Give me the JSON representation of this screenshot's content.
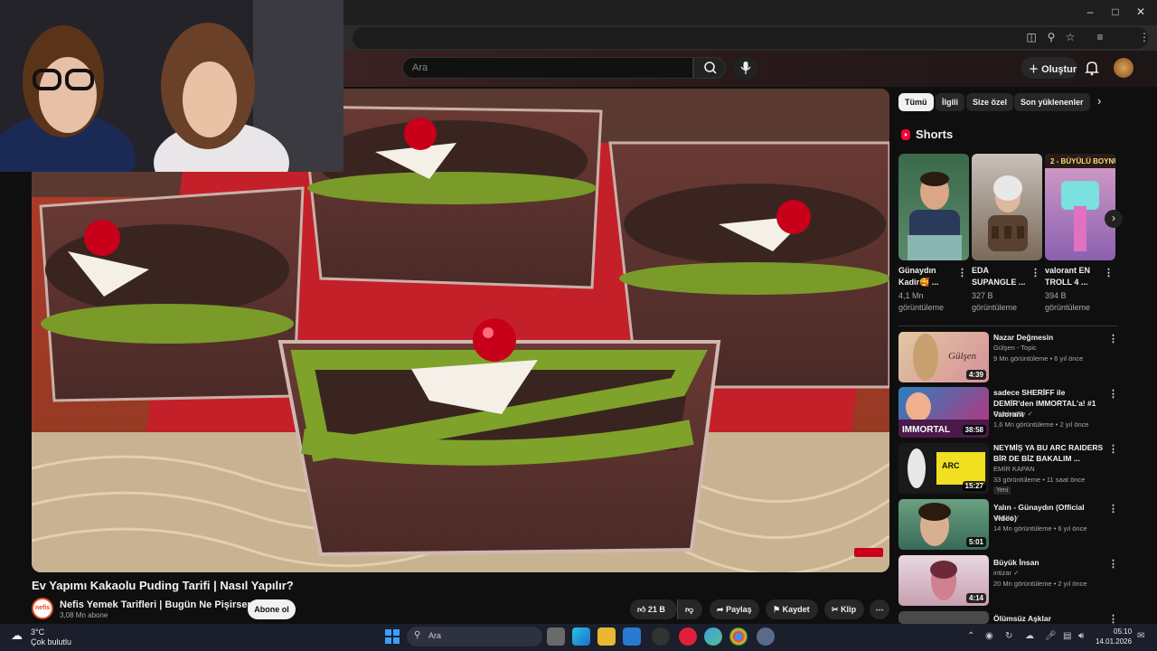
{
  "search": {
    "placeholder": "Ara"
  },
  "header": {
    "create_label": "Oluştur"
  },
  "video": {
    "title": "Ev Yapımı Kakaolu Puding Tarifi | Nasıl Yapılır?",
    "channel": "Nefis Yemek Tarifleri | Bugün Ne Pişirsem?",
    "subscribers": "3,08 Mn abone",
    "subscribe_label": "Abone ol",
    "channel_logo_text": "nefis",
    "likes": "21 B",
    "share_label": "Paylaş",
    "save_label": "Kaydet",
    "clip_label": "Klip"
  },
  "chips": [
    "Tümü",
    "İlgili",
    "Size özel",
    "Son yüklenenler"
  ],
  "shorts_title": "Shorts",
  "shorts": [
    {
      "title": "Günaydın Kadir🥰 ...",
      "views": "4,1 Mn görüntüleme"
    },
    {
      "title": "EDA SUPANGLE ...",
      "views": "327 B görüntüleme"
    },
    {
      "title": "valorant EN TROLL 4 ...",
      "views": "394 B görüntüleme",
      "overlay": "2 - BÜYÜLÜ BOYNUZ"
    }
  ],
  "recommendations": [
    {
      "title": "Nazar Değmesin",
      "channel": "Gülşen - Topic",
      "meta": "9 Mn görüntüleme • 6 yıl önce",
      "duration": "4:39"
    },
    {
      "title": "sadece SHERİFF ile DEMİR'den IMMORTAL'a! #1 Valorant",
      "channel": "CombatRy ✓",
      "meta": "1,6 Mn görüntüleme • 2 yıl önce",
      "duration": "38:58"
    },
    {
      "title": "NEYMİŞ YA BU ARC RAIDERS BİR DE BİZ BAKALIM ...",
      "channel": "EMİR KAPAN",
      "meta": "33 görüntüleme • 11 saat önce",
      "duration": "15:27",
      "badge": "Yeni"
    },
    {
      "title": "Yalın - Günaydın (Official Video)",
      "channel": "YALIN ✓",
      "meta": "14 Mn görüntüleme • 6 yıl önce",
      "duration": "5:01"
    },
    {
      "title": "Büyük İnsan",
      "channel": "intizar ✓",
      "meta": "20 Mn görüntüleme • 2 yıl önce",
      "duration": "4:14"
    },
    {
      "title": "Ölümsüz Aşklar"
    }
  ],
  "taskbar": {
    "weather_temp": "3°C",
    "weather_desc": "Çok bulutlu",
    "search_label": "Ara",
    "time": "05:10",
    "date": "14.01.2026"
  },
  "colors": {
    "accent_red": "#ff0033",
    "background": "#0f0f0f",
    "taskbar": "#1b1e2b"
  },
  "icons": [
    "minimize-icon",
    "maximize-icon",
    "close-icon",
    "search-icon",
    "mic-icon",
    "plus-icon",
    "bell-icon",
    "like-icon",
    "dislike-icon",
    "share-icon",
    "save-icon",
    "scissors-icon",
    "more-icon",
    "shorts-icon",
    "chevron-right-icon",
    "windows-start-icon"
  ]
}
